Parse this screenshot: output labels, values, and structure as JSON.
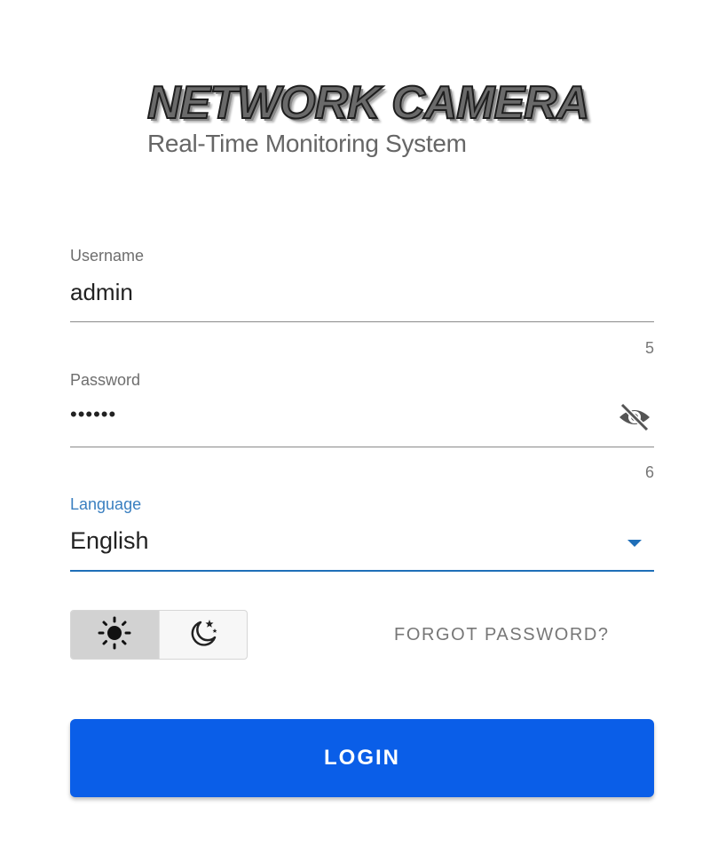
{
  "logo": {
    "title": "NETWORK CAMERA",
    "subtitle": "Real-Time Monitoring System"
  },
  "form": {
    "username": {
      "label": "Username",
      "value": "admin",
      "counter": "5"
    },
    "password": {
      "label": "Password",
      "value": "••••••",
      "counter": "6",
      "visibility_icon": "eye-off-icon"
    },
    "language": {
      "label": "Language",
      "selected": "English",
      "dropdown_icon": "caret-down-icon"
    }
  },
  "theme": {
    "options": [
      {
        "icon": "sun-icon",
        "active": true
      },
      {
        "icon": "moon-stars-icon",
        "active": false
      }
    ]
  },
  "links": {
    "forgot_password": "FORGOT PASSWORD?"
  },
  "actions": {
    "login_label": "LOGIN"
  },
  "colors": {
    "primary": "#0a5ee8",
    "focus": "#1f6fb8",
    "text": "#222222",
    "muted": "#777777"
  }
}
